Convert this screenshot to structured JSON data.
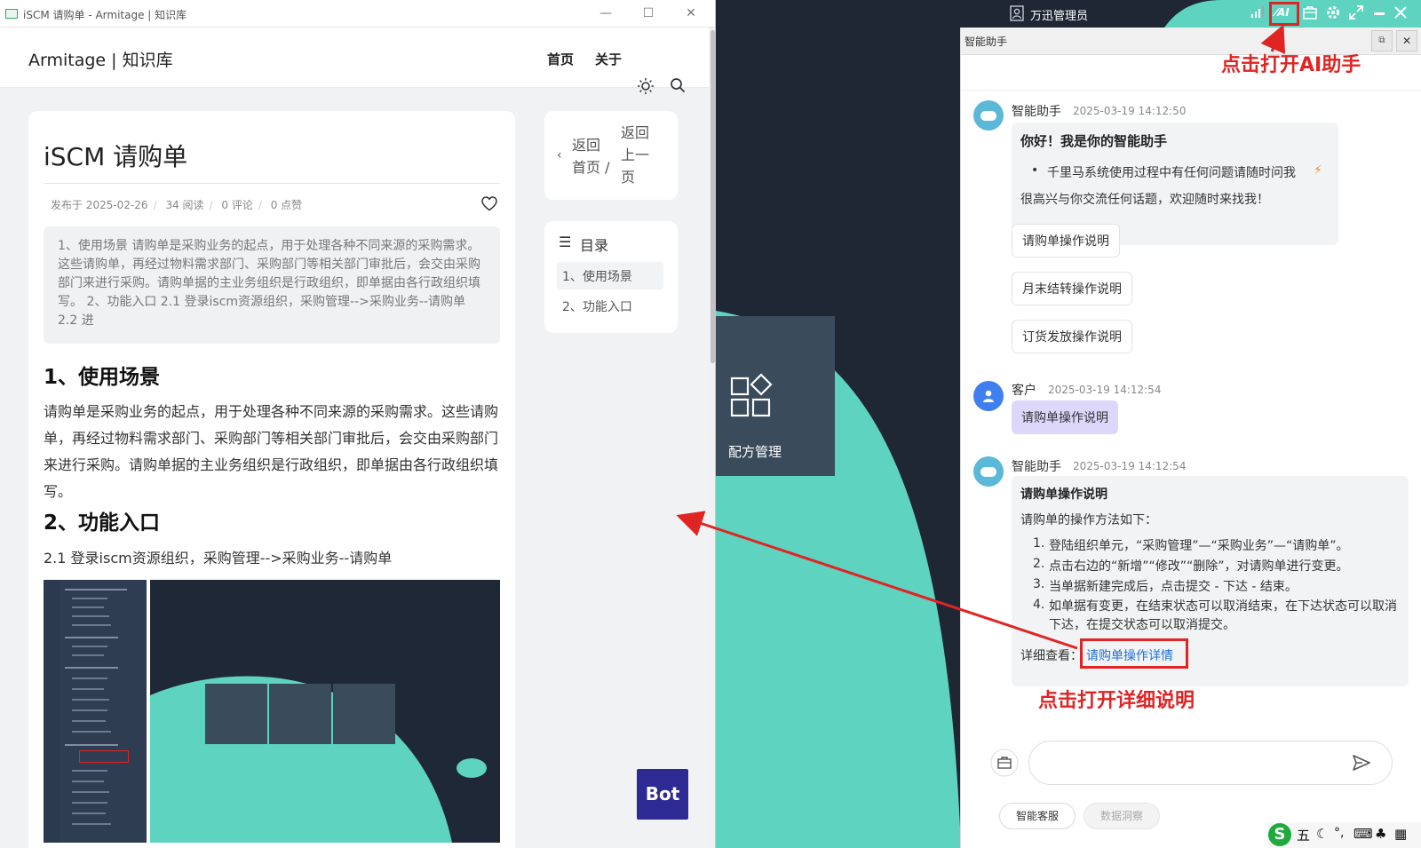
{
  "left_window": {
    "title": "iSCM 请购单 - Armitage | 知识库",
    "minimize": "—",
    "maximize": "☐",
    "close": "✕",
    "brand": "Armitage | 知识库",
    "nav": [
      "首页",
      "关于"
    ],
    "article": {
      "title": "iSCM 请购单",
      "meta": [
        "发布于 2025-02-26",
        "34 阅读",
        "0 评论",
        "0 点赞"
      ],
      "summary": "1、使用场景 请购单是采购业务的起点，用于处理各种不同来源的采购需求。这些请购单，再经过物料需求部门、采购部门等相关部门审批后，会交由采购部门来进行采购。请购单据的主业务组织是行政组织，即单据由各行政组织填写。 2、功能入口 2.1 登录iscm资源组织，采购管理-->采购业务--请购单 2.2 进",
      "section1_title": "1、使用场景",
      "section1_text": "请购单是采购业务的起点，用于处理各种不同来源的采购需求。这些请购单，再经过物料需求部门、采购部门等相关部门审批后，会交由采购部门来进行采购。请购单据的主业务组织是行政组织，即单据由各行政组织填写。",
      "section2_title": "2、功能入口",
      "section2_text": "2.1 登录iscm资源组织，采购管理-->采购业务--请购单"
    },
    "back": {
      "home": "返回首页 /",
      "prev": "返回上一页"
    },
    "toc": {
      "title": "目录",
      "items": [
        "1、使用场景",
        "2、功能入口"
      ]
    },
    "bot_label": "Bot"
  },
  "desktop": {
    "user": "万迅管理员",
    "tile_label": "配方管理"
  },
  "assistant": {
    "title": "智能助手",
    "annotation_top": "点击打开AI助手",
    "annotation_bottom": "点击打开详细说明",
    "msg1": {
      "sender": "智能助手",
      "time": "2025-03-19 14:12:50",
      "heading": "你好！我是你的智能助手",
      "bullet": "千里马系统使用过程中有任何问题请随时问我",
      "closing": "很高兴与你交流任何话题，欢迎随时来找我！"
    },
    "suggestions": [
      "请购单操作说明",
      "月末结转操作说明",
      "订货发放操作说明"
    ],
    "msg2": {
      "sender": "客户",
      "time": "2025-03-19 14:12:54",
      "text": "请购单操作说明"
    },
    "msg3": {
      "sender": "智能助手",
      "time": "2025-03-19 14:12:54",
      "heading": "请购单操作说明",
      "intro": "请购单的操作方法如下：",
      "steps": [
        "登陆组织单元，“采购管理”—“采购业务”—“请购单”。",
        "点击右边的“新增”“修改”“删除”，对请购单进行变更。",
        "当单据新建完成后，点击提交 - 下达 - 结束。",
        "如单据有变更，在结束状态可以取消结束，在下达状态可以取消下达，在提交状态可以取消提交。"
      ],
      "detail_prefix": "详细查看：",
      "detail_link": "请购单操作详情"
    },
    "buttons": [
      "智能客服",
      "数据洞察"
    ]
  },
  "colors": {
    "teal": "#5ed3c0",
    "dark": "#1f2735",
    "red": "#e02424",
    "link": "#1e6fd9"
  }
}
